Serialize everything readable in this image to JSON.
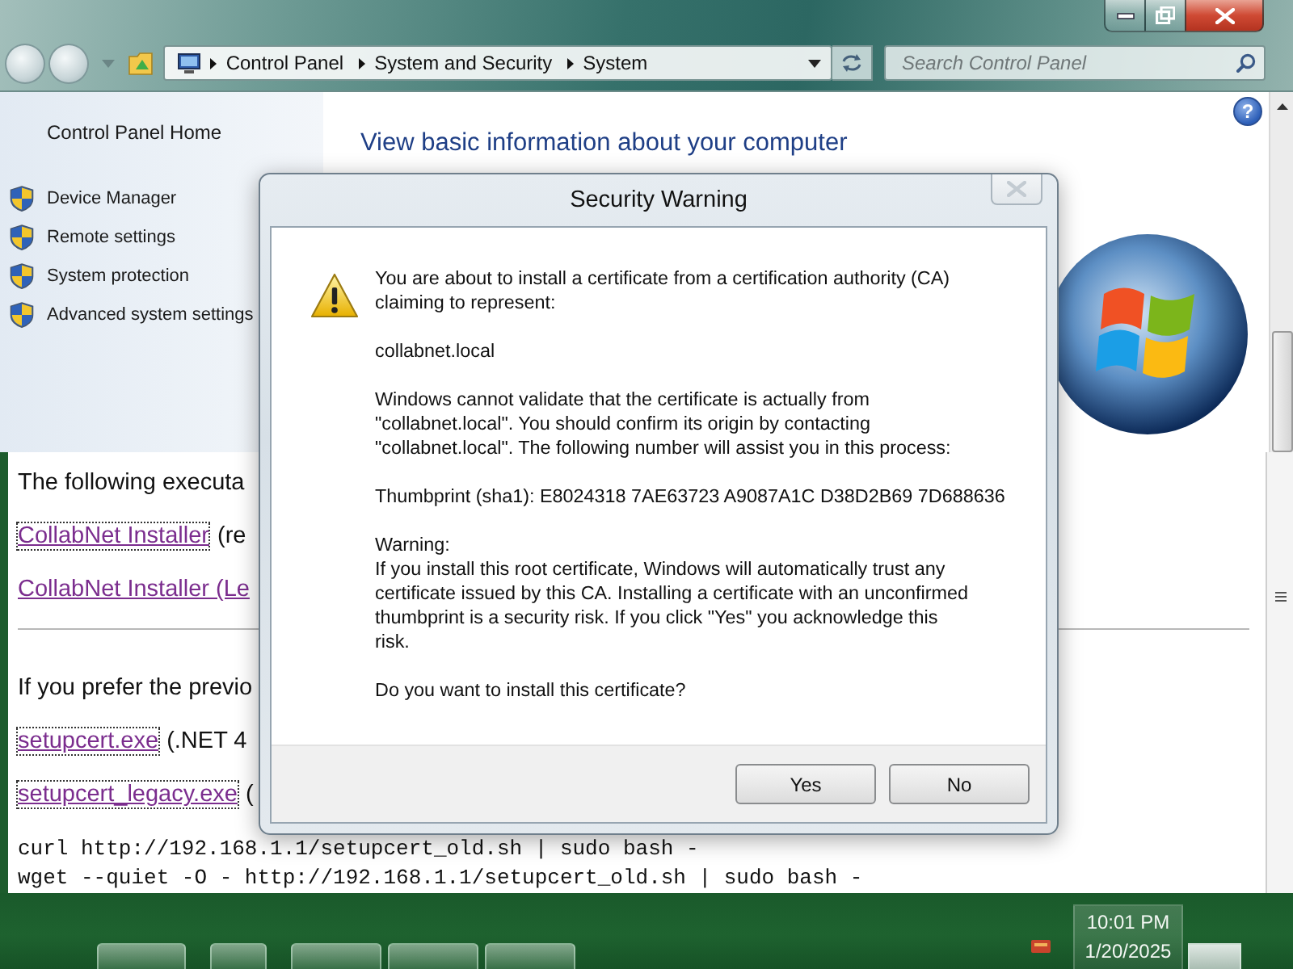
{
  "control_panel": {
    "breadcrumb": [
      "Control Panel",
      "System and Security",
      "System"
    ],
    "search": {
      "placeholder": "Search Control Panel"
    },
    "sidebar": {
      "home_link": "Control Panel Home",
      "items": [
        "Device Manager",
        "Remote settings",
        "System protection",
        "Advanced system settings"
      ]
    },
    "heading": "View basic information about your computer",
    "help_button": "?"
  },
  "web_page": {
    "lines": [
      {
        "kind": "text",
        "text": "The following executa"
      },
      {
        "kind": "link",
        "link": "CollabNet Installer",
        "focused": true,
        "rest": "(re"
      },
      {
        "kind": "link",
        "link": "CollabNet Installer (Le",
        "focused": false
      },
      {
        "kind": "rule"
      },
      {
        "kind": "text",
        "text": "If you prefer the previo"
      },
      {
        "kind": "link",
        "link": "setupcert.exe",
        "focused": true,
        "rest": "(.NET 4"
      },
      {
        "kind": "link",
        "link": "setupcert_legacy.exe",
        "focused": true,
        "rest": "("
      },
      {
        "kind": "code",
        "text": "curl http://192.168.1.1/setupcert_old.sh | sudo bash -"
      },
      {
        "kind": "code",
        "text": "wget --quiet -O - http://192.168.1.1/setupcert_old.sh | sudo bash -"
      }
    ]
  },
  "dialog": {
    "title": "Security Warning",
    "close_button": {
      "disabled": true
    },
    "paragraphs": [
      "You are about to install a certificate from a certification authority (CA)\nclaiming to represent:",
      "collabnet.local",
      "Windows cannot validate that the certificate is actually from\n\"collabnet.local\". You should confirm its origin by contacting\n\"collabnet.local\". The following number will assist you in this process:",
      "Thumbprint (sha1): E8024318 7AE63723 A9087A1C D38D2B69 7D688636",
      "Warning:\nIf you install this root certificate, Windows will automatically trust any\ncertificate issued by this CA. Installing a certificate with an unconfirmed\nthumbprint is a security risk. If you click \"Yes\" you acknowledge this\nrisk.",
      "Do you want to install this certificate?"
    ],
    "buttons": [
      "Yes",
      "No"
    ]
  },
  "taskbar": {
    "time": "10:01 PM",
    "date": "1/20/2025"
  }
}
